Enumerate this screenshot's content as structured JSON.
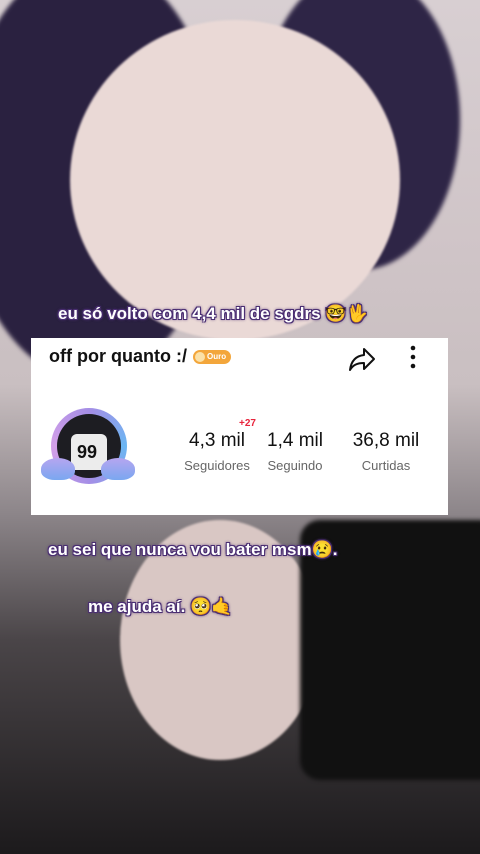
{
  "captions": {
    "line1": "eu só volto com 4,4 mil de sgdrs",
    "line2": "eu sei que nunca vou bater msm",
    "line2_end": ".",
    "line3": "me ajuda aí."
  },
  "emoji": {
    "nerd": "🤓",
    "vulcan": "🖖",
    "crying": "😢",
    "pleading": "🥺",
    "call_me": "🤙"
  },
  "profile": {
    "username": "off por quanto :/",
    "badge_label": "Ouro",
    "jersey_number": "99",
    "new_followers": "+27",
    "stats": [
      {
        "value": "4,3 mil",
        "label": "Seguidores"
      },
      {
        "value": "1,4 mil",
        "label": "Seguindo"
      },
      {
        "value": "36,8 mil",
        "label": "Curtidas"
      }
    ]
  },
  "colors": {
    "badge": "#f3a63b",
    "new_followers": "#e8243c",
    "caption_outline": "#4b2f73"
  },
  "icons": [
    "share-icon",
    "more-vertical-icon"
  ]
}
